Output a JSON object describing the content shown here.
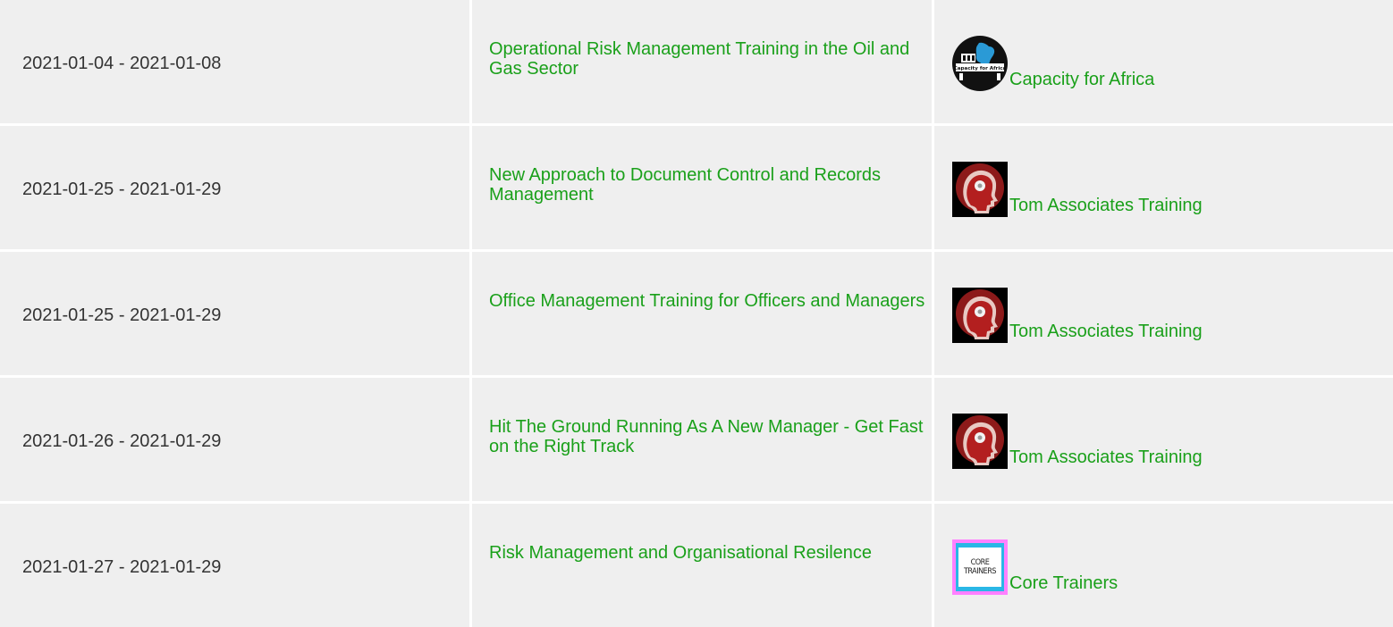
{
  "rows": [
    {
      "date": "2021-01-04 - 2021-01-08",
      "course": "Operational Risk Management Training in the Oil and Gas Sector",
      "provider": "Capacity for Africa",
      "logo": "capacity-for-africa-logo"
    },
    {
      "date": "2021-01-25 - 2021-01-29",
      "course": "New Approach to Document Control and Records Management",
      "provider": "Tom Associates Training",
      "logo": "tom-associates-logo"
    },
    {
      "date": "2021-01-25 - 2021-01-29",
      "course": "Office Management Training for Officers and Managers",
      "provider": "Tom Associates Training",
      "logo": "tom-associates-logo"
    },
    {
      "date": "2021-01-26 - 2021-01-29",
      "course": "Hit The Ground Running As A New Manager - Get Fast on the Right Track",
      "provider": "Tom Associates Training",
      "logo": "tom-associates-logo"
    },
    {
      "date": "2021-01-27 - 2021-01-29",
      "course": "Risk Management and Organisational Resilence",
      "provider": "Core Trainers",
      "logo": "core-trainers-logo"
    }
  ],
  "logos": {
    "capacity_text": "Capacity for Africa",
    "core_line1": "CORE",
    "core_line2": "TRAINERS"
  },
  "colors": {
    "link": "#1aa01a",
    "text": "#333333",
    "cell_bg": "#efefef",
    "grid": "#ffffff"
  }
}
